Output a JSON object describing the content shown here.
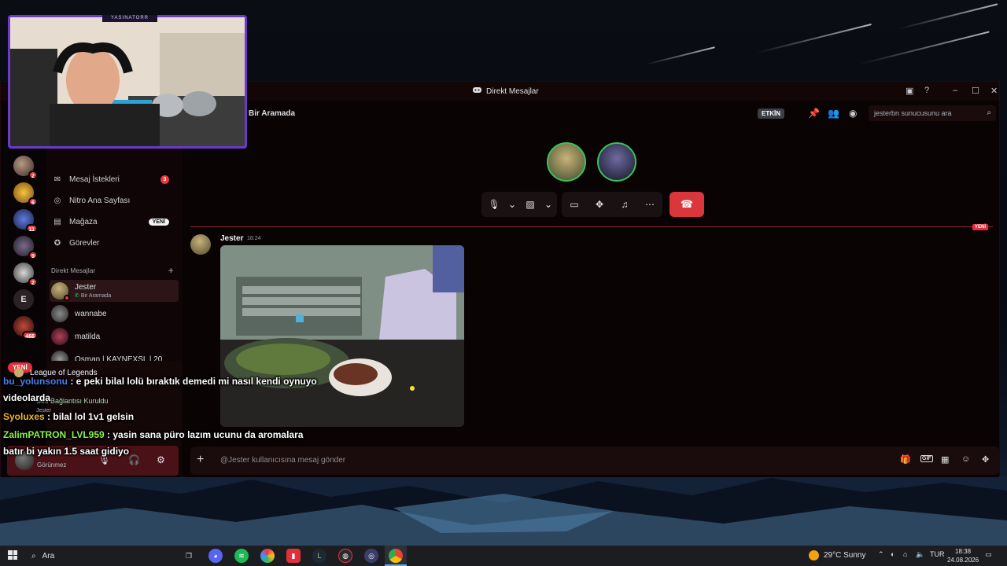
{
  "window": {
    "title": "Direkt Mesajlar",
    "controls": [
      "inbox-icon",
      "help-icon",
      "minimize-icon",
      "maximize-icon",
      "close-icon"
    ]
  },
  "servers": {
    "badges": [
      "2",
      "6",
      "11",
      "9",
      "2",
      "466"
    ],
    "letter_server": "E",
    "new_pill": "YENİ"
  },
  "sidebar": {
    "nav": [
      {
        "label": "Mesaj İstekleri",
        "icon": "mail-icon",
        "badge": "3"
      },
      {
        "label": "Nitro Ana Sayfası",
        "icon": "nitro-icon"
      },
      {
        "label": "Mağaza",
        "icon": "store-icon",
        "tag": "YENİ"
      },
      {
        "label": "Görevler",
        "icon": "quests-icon"
      }
    ],
    "dm_header": "Direkt Mesajlar",
    "dms": [
      {
        "name": "Jester",
        "sub": "Bir Aramada"
      },
      {
        "name": "wannabe"
      },
      {
        "name": "matilda"
      },
      {
        "name": "Osman | KAYNEXSL | 20"
      }
    ]
  },
  "voice": {
    "activity": "League of Legends",
    "status": "Ses Bağlantısı Kuruldu",
    "channel": "Jester"
  },
  "user_panel": {
    "status": "Görünmez"
  },
  "call": {
    "header_label": "Bir Aramada",
    "etkin": "ETKİN",
    "search_placeholder": "jesterbn sunucusunu ara",
    "new_tag": "YENİ"
  },
  "message": {
    "author": "Jester",
    "time": "18:24"
  },
  "composer": {
    "placeholder": "@Jester kullanıcısına mesaj gönder",
    "gif": "GIF"
  },
  "webcam": {
    "label": "YASINATORR"
  },
  "chat": [
    {
      "user": "bu_yolunsonu",
      "color": "#4a7df0",
      "text": " : e peki bilal lolü bıraktık demedi mi nasıl kendi oynuyo",
      "cont": "videolarda"
    },
    {
      "user": "Syoluxes",
      "color": "#f0b429",
      "text": " : bilal lol 1v1 gelsin"
    },
    {
      "user": "ZalimPATRON_LVL959",
      "color": "#8ef04a",
      "text": " : yasin sana püro lazım ucunu da aromalara",
      "cont": "batır bi yakın 1.5 saat gidiyo"
    }
  ],
  "taskbar": {
    "search": "Ara",
    "weather": "29°C  Sunny",
    "lang": "TUR",
    "time": "18:38",
    "date": "24.08.2026"
  },
  "colors": {
    "accent_red": "#da373c",
    "badge_red": "#e7393e",
    "speaking_green": "#36c55c",
    "webcam_frame": "#6b3ac9"
  }
}
